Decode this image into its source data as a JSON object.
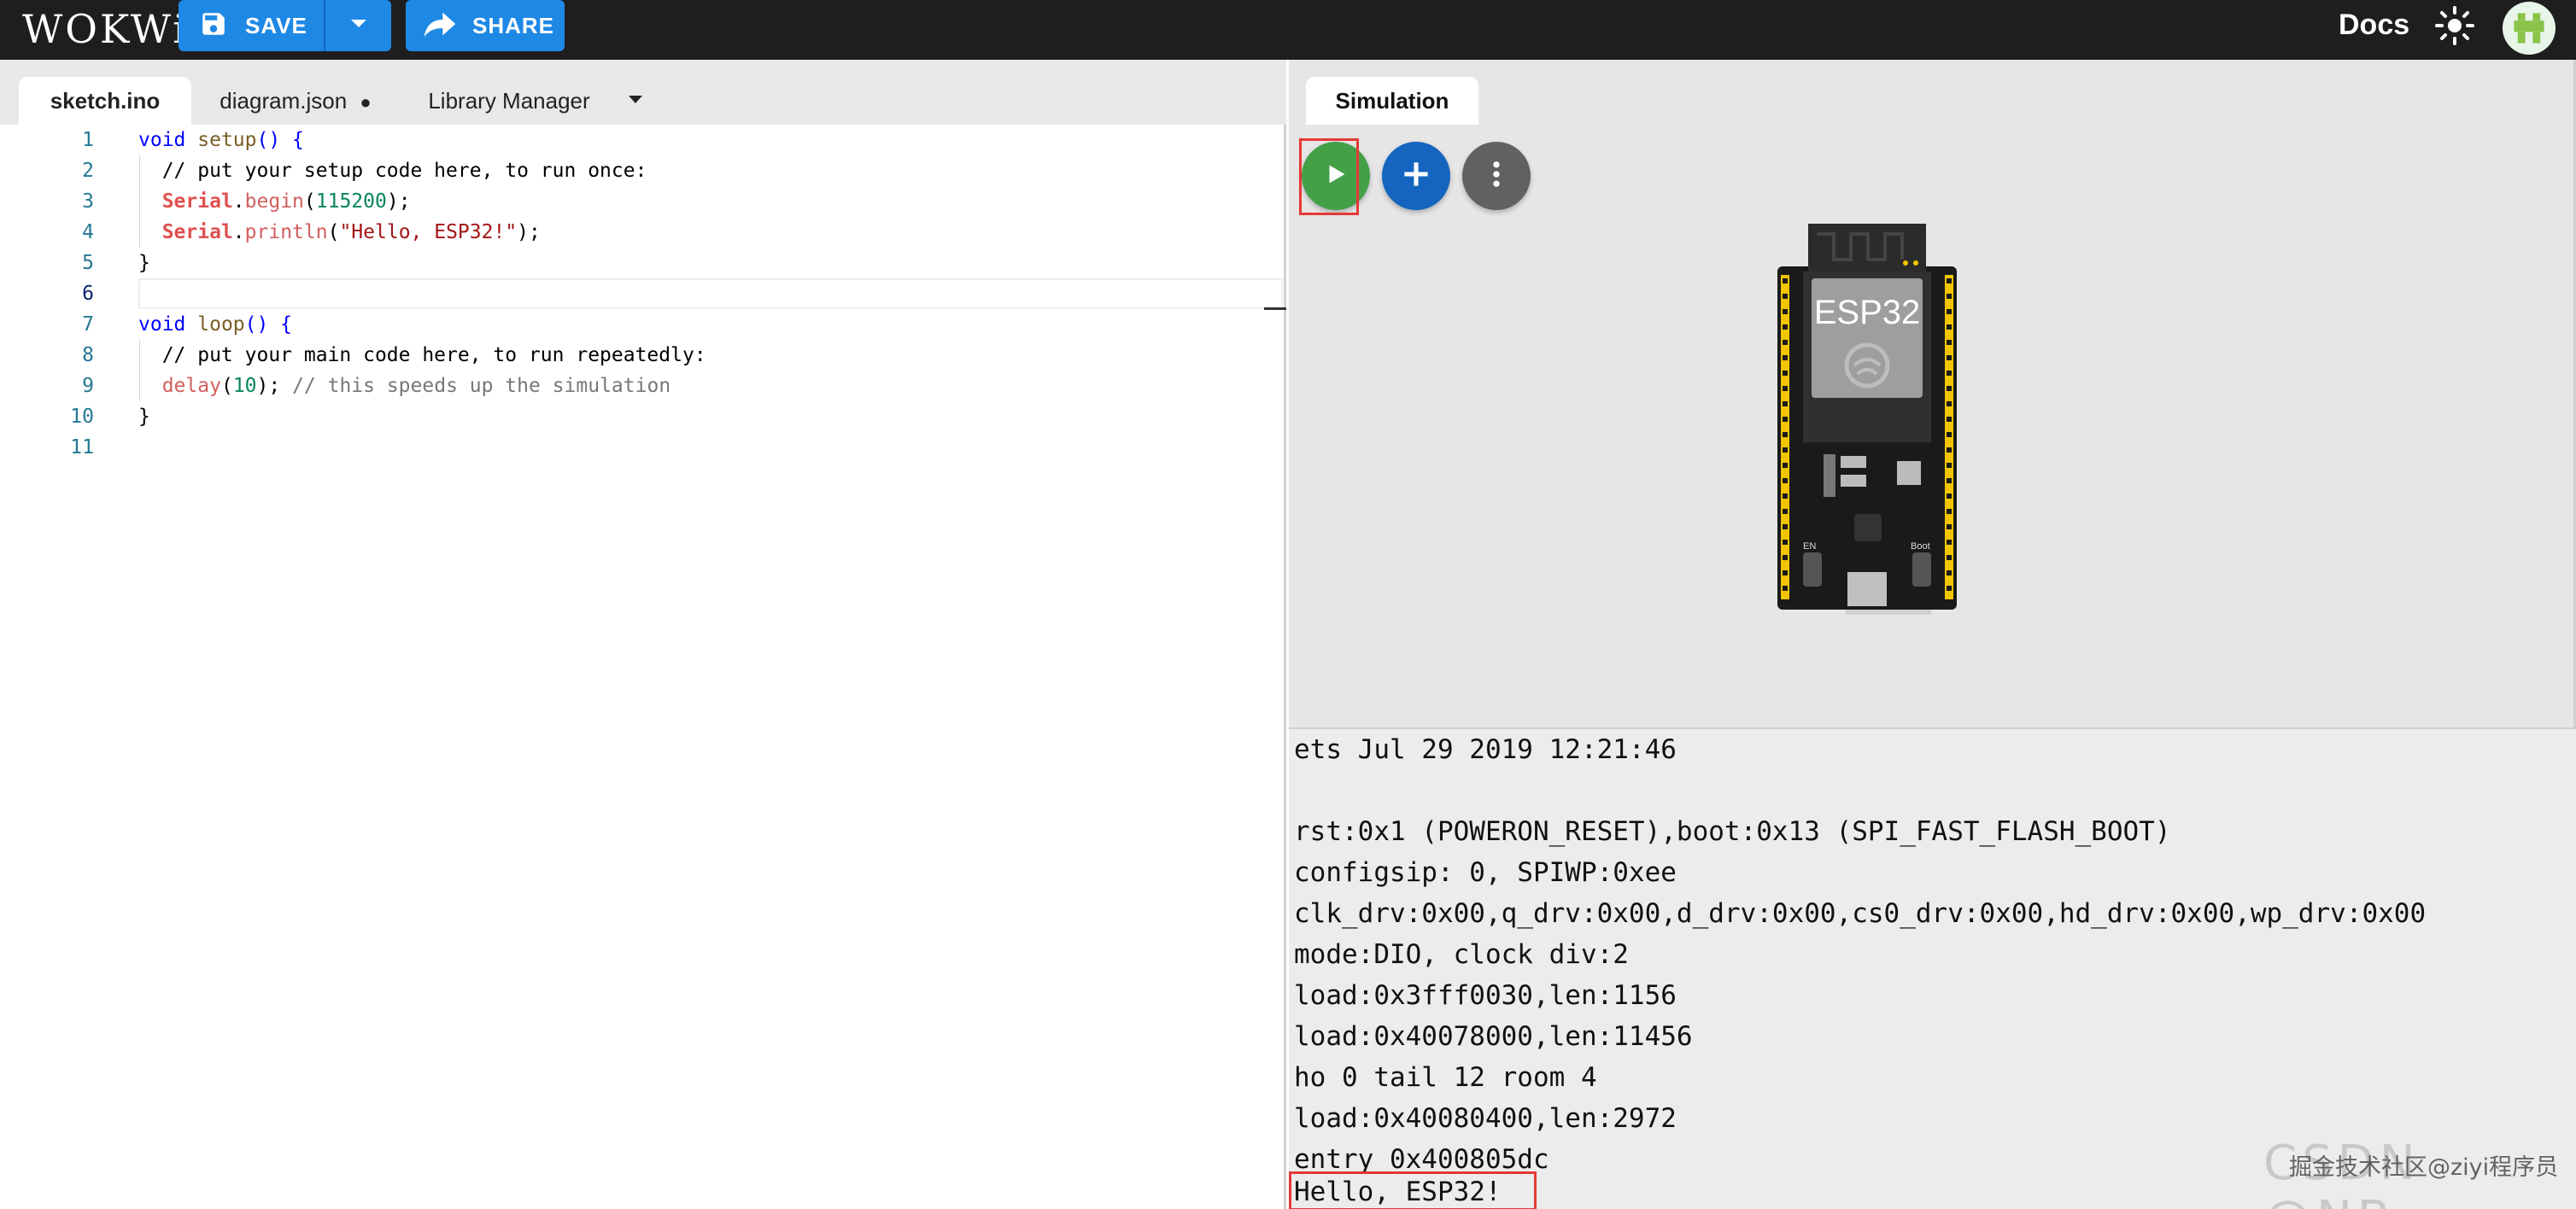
{
  "app": {
    "logo": "WOKWi",
    "save_label": "SAVE",
    "share_label": "SHARE",
    "docs_label": "Docs"
  },
  "editor": {
    "tabs": [
      {
        "label": "sketch.ino",
        "active": true
      },
      {
        "label": "diagram.json",
        "modified_marker": "●"
      },
      {
        "label": "Library Manager"
      }
    ],
    "current_line": 6,
    "lines": [
      {
        "n": "1",
        "text": "void setup() {"
      },
      {
        "n": "2",
        "text": "  // put your setup code here, to run once:"
      },
      {
        "n": "3",
        "text": "  Serial.begin(115200);"
      },
      {
        "n": "4",
        "text": "  Serial.println(\"Hello, ESP32!\");"
      },
      {
        "n": "5",
        "text": "}"
      },
      {
        "n": "6",
        "text": ""
      },
      {
        "n": "7",
        "text": "void loop() {"
      },
      {
        "n": "8",
        "text": "  // put your main code here, to run repeatedly:"
      },
      {
        "n": "9",
        "text": "  delay(10); // this speeds up the simulation"
      },
      {
        "n": "10",
        "text": "}"
      },
      {
        "n": "11",
        "text": ""
      }
    ]
  },
  "simulation": {
    "tab_label": "Simulation",
    "board_label": "ESP32",
    "board_small_labels": [
      "EN",
      "Boot"
    ],
    "buttons": [
      {
        "name": "play",
        "icon": "play-icon",
        "color": "#43a047"
      },
      {
        "name": "add-part",
        "icon": "plus-icon",
        "color": "#1565c0"
      },
      {
        "name": "more",
        "icon": "more-vert-icon",
        "color": "#616161"
      }
    ]
  },
  "serial": {
    "lines": [
      "ets Jul 29 2019 12:21:46",
      "",
      "rst:0x1 (POWERON_RESET),boot:0x13 (SPI_FAST_FLASH_BOOT)",
      "configsip: 0, SPIWP:0xee",
      "clk_drv:0x00,q_drv:0x00,d_drv:0x00,cs0_drv:0x00,hd_drv:0x00,wp_drv:0x00",
      "mode:DIO, clock div:2",
      "load:0x3fff0030,len:1156",
      "load:0x40078000,len:11456",
      "ho 0 tail 12 room 4",
      "load:0x40080400,len:2972",
      "entry 0x400805dc",
      "Hello, ESP32!"
    ]
  },
  "watermark": {
    "faint": "CSDN @NB~",
    "text": "掘金技术社区@ziyi程序员"
  },
  "colors": {
    "topbar": "#1e1e1e",
    "accent": "#1e88e5",
    "highlight": "#e53935"
  }
}
